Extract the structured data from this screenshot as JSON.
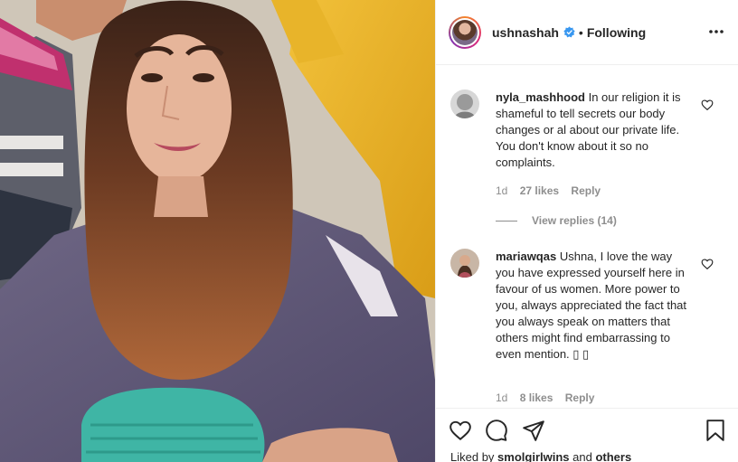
{
  "post": {
    "username": "ushnashah",
    "separator": "•",
    "follow_state": "Following"
  },
  "comments": [
    {
      "username": "nyla_mashhood",
      "text": "In our religion it is shameful to tell secrets our body changes or al about our private life. You don't know about it so no complaints.",
      "age": "1d",
      "likes": "27 likes",
      "reply_label": "Reply",
      "view_replies": "View replies (14)"
    },
    {
      "username": "mariawqas",
      "text": "Ushna, I love the way you have expressed yourself here in favour of us women. More power to you, always appreciated the fact that you always speak on matters that others might find embarrassing to even mention. ▯ ▯",
      "age": "1d",
      "likes": "8 likes",
      "reply_label": "Reply"
    }
  ],
  "likes_line": {
    "prefix": "Liked by",
    "user": "smolgirlwins",
    "connector": "and",
    "others": "others"
  },
  "icons": {
    "verified": "verified-badge-icon",
    "more": "more-options-icon",
    "heart": "heart-icon",
    "comment": "comment-icon",
    "share": "share-icon",
    "save": "bookmark-icon"
  },
  "colors": {
    "verified": "#3897f0",
    "muted_text": "#8e8e8e",
    "text": "#262626"
  }
}
